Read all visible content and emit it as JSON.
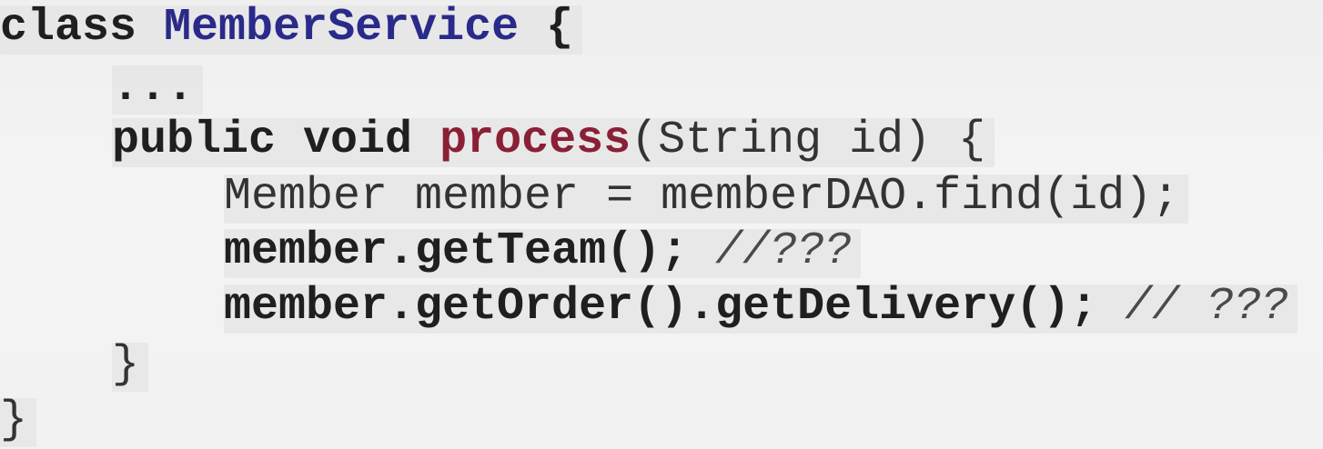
{
  "code": {
    "line1": {
      "keyword": "class",
      "class_name": "MemberService",
      "brace": "{"
    },
    "line2": {
      "ellipsis": "..."
    },
    "line3": {
      "modifiers": "public void",
      "method": "process",
      "params": "(String id) {"
    },
    "line4": {
      "text": "Member member = memberDAO.find(id);"
    },
    "line5": {
      "call": "member.getTeam();",
      "comment": "//???"
    },
    "line6": {
      "call": "member.getOrder().getDelivery();",
      "comment": "// ???"
    },
    "line7": {
      "brace": "}"
    },
    "line8": {
      "brace": "}"
    }
  },
  "colors": {
    "class_name": "#2a2a8a",
    "method_name": "#8a1f35",
    "text": "#2a2a2a",
    "background": "#f2f2f2"
  }
}
